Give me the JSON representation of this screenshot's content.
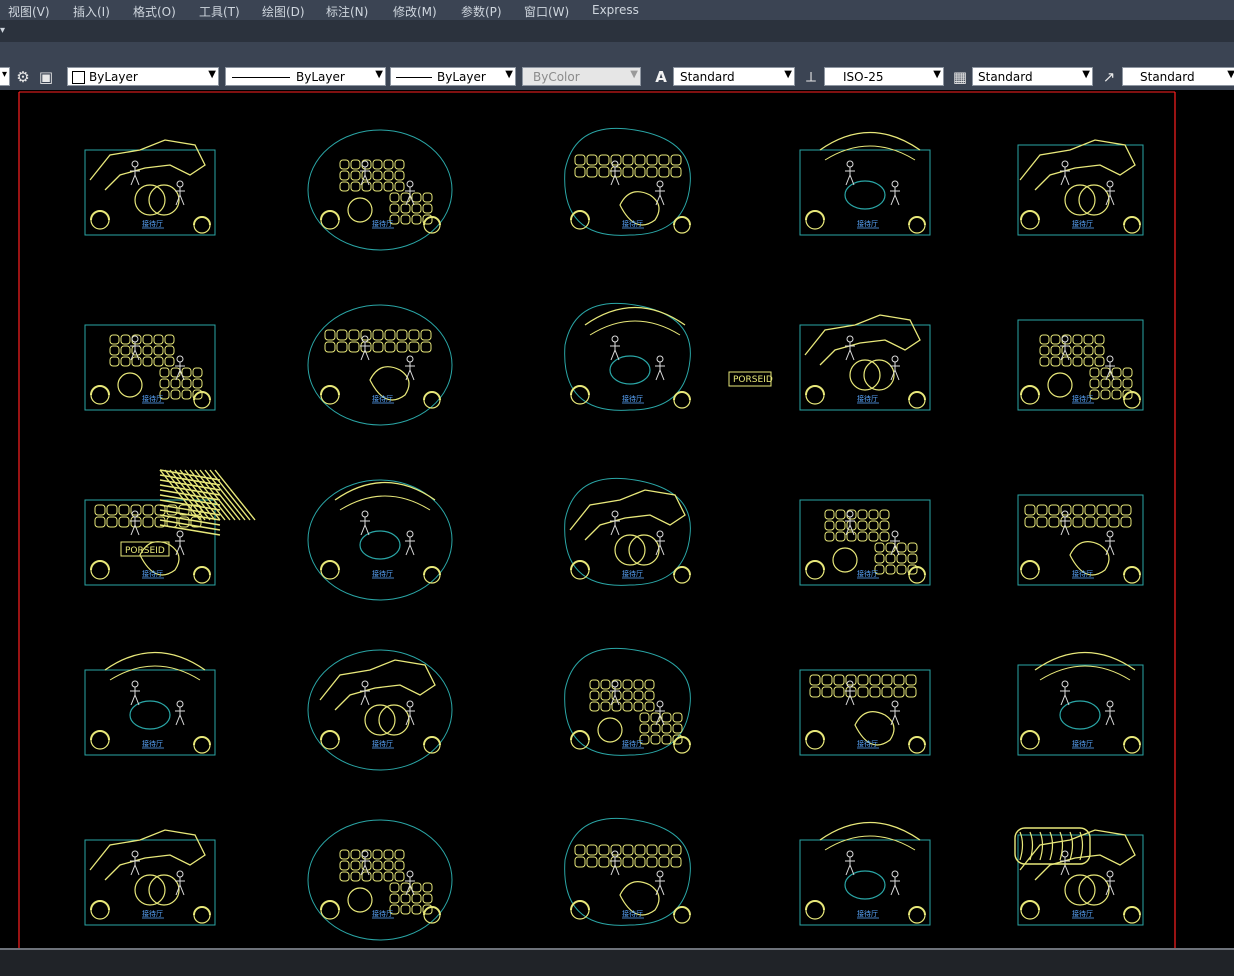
{
  "menu": {
    "items": [
      "视图(V)",
      "插入(I)",
      "格式(O)",
      "工具(T)",
      "绘图(D)",
      "标注(N)",
      "修改(M)",
      "参数(P)",
      "窗口(W)",
      "Express"
    ]
  },
  "toolbar": {
    "color_label": "ByLayer",
    "linetype_label": "ByLayer",
    "lineweight_label": "ByLayer",
    "plotstyle_label": "ByColor",
    "textstyle_label": "Standard",
    "dimstyle_label": "ISO-25",
    "tablestyle_label": "Standard",
    "mleaderstyle_label": "Standard"
  },
  "drawing": {
    "background_color": "#000000",
    "border_color": "#ff2020",
    "furniture_color": "#e8e87a",
    "boundary_color": "#2aa6a6",
    "label_color": "#5aa8ff",
    "logo_text": "PORSEID",
    "area_label": "接待厅"
  }
}
